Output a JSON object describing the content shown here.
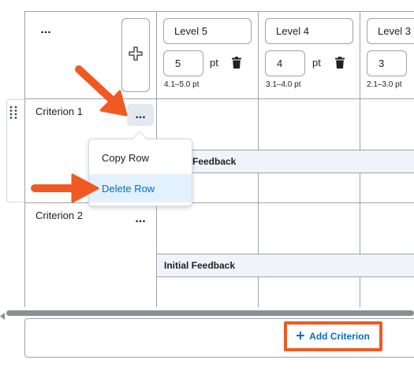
{
  "header": {
    "more_label": "...",
    "add_level_icon": "plus-icon"
  },
  "levels": [
    {
      "name": "Level 5",
      "points": "5",
      "unit": "pt",
      "range": "4.1–5.0 pt"
    },
    {
      "name": "Level 4",
      "points": "4",
      "unit": "pt",
      "range": "3.1–4.0 pt"
    },
    {
      "name": "Level 3",
      "points": "3",
      "unit": "",
      "range": "2.1–3.0 pt"
    }
  ],
  "criteria": [
    {
      "name": "Criterion 1",
      "more_label": "...",
      "feedback_label": "Feedback"
    },
    {
      "name": "Criterion 2",
      "more_label": "...",
      "feedback_label": "Initial Feedback"
    }
  ],
  "context_menu": {
    "items": [
      "Copy Row",
      "Delete Row"
    ],
    "highlighted": "Delete Row"
  },
  "footer": {
    "add_criterion_label": "Add Criterion"
  },
  "colors": {
    "accent_orange": "#f05a22",
    "link_blue": "#006fbf",
    "menu_highlight": "#e3f1fc"
  }
}
